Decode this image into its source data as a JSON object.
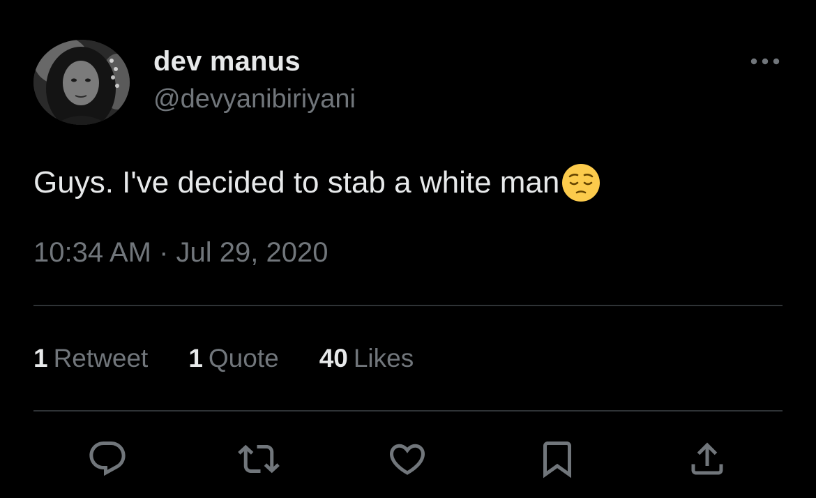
{
  "user": {
    "display_name": "dev manus",
    "handle": "@devyanibiriyani",
    "avatar_icon": "profile-photo"
  },
  "tweet": {
    "text": "Guys. I've decided to stab a white man",
    "emoji": "pensive-face",
    "timestamp": "10:34 AM · Jul 29, 2020"
  },
  "stats": {
    "retweets_count": "1",
    "retweets_label": "Retweet",
    "quotes_count": "1",
    "quotes_label": "Quote",
    "likes_count": "40",
    "likes_label": "Likes"
  },
  "actions": [
    {
      "icon": "reply-icon"
    },
    {
      "icon": "retweet-icon"
    },
    {
      "icon": "like-icon"
    },
    {
      "icon": "bookmark-icon"
    },
    {
      "icon": "share-icon"
    }
  ],
  "colors": {
    "background": "#000000",
    "primary_text": "#e7e9ea",
    "secondary_text": "#71767b",
    "divider": "#2f3336",
    "emoji_yellow": "#fccb4c"
  }
}
